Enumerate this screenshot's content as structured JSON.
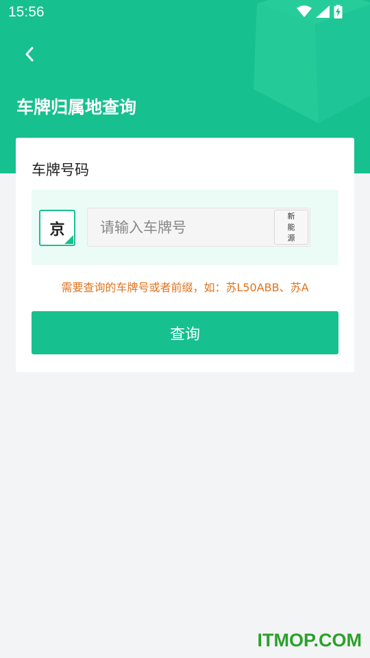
{
  "status_bar": {
    "time": "15:56",
    "icons": [
      "wifi-icon",
      "signal-icon",
      "battery-charging-icon"
    ]
  },
  "header": {
    "back_icon": "chevron-left-icon",
    "title": "车牌归属地查询",
    "background_color": "#17c08f"
  },
  "form": {
    "label": "车牌号码",
    "province": "京",
    "plate_input": {
      "value": "",
      "placeholder": "请输入车牌号"
    },
    "new_energy_label": [
      "新",
      "能",
      "源"
    ],
    "hint": "需要查询的车牌号或者前缀，如：苏L50ABB、苏A",
    "hint_color": "#e0731c",
    "query_button": "查询"
  },
  "watermark": "ITMOP.COM"
}
